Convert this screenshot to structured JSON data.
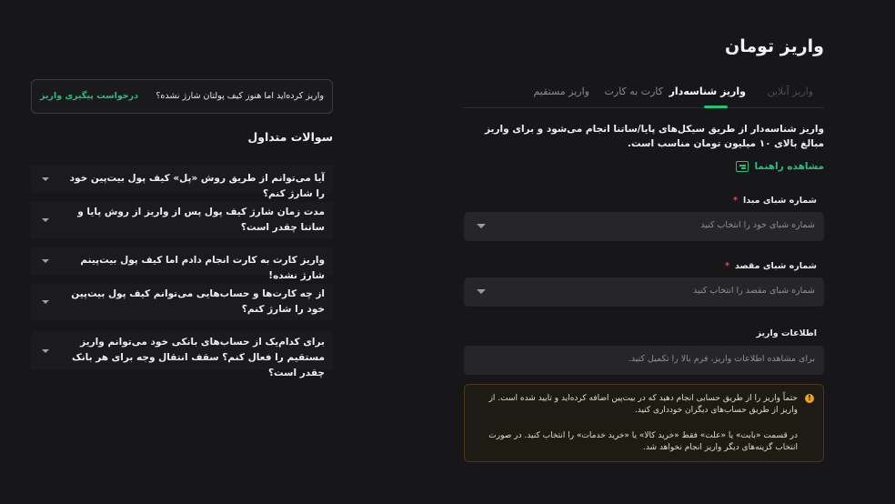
{
  "page": {
    "title": "واریز تومان"
  },
  "tabs": [
    {
      "label": "واریز آنلاین"
    },
    {
      "label": "واریز شناسه‌دار"
    },
    {
      "label": "کارت به کارت"
    },
    {
      "label": "واریز مستقیم"
    }
  ],
  "active_tab": "واریز شناسه‌دار",
  "description": "واریز شناسه‌دار از طریق سیکل‌های پایا/ساتنا انجام می‌شود و برای واریز مبالغ بالای ۱۰ میلیون تومان مناسب است.",
  "guide_link": "مشاهده راهنما",
  "fields": {
    "source_label": "شماره شبای مبدا",
    "source_placeholder": "شماره شبای خود را انتخاب کنید",
    "dest_label": "شماره شبای مقصد",
    "dest_placeholder": "شماره شبای مقصد را انتخاب کنید",
    "required_mark": "*",
    "info_label": "اطلاعات واریز",
    "info_placeholder": "برای مشاهده اطلاعات واریز، فرم بالا را تکمیل کنید."
  },
  "warning": {
    "icon": "!",
    "p1": "حتماً واریز را از طریق حسابی انجام دهید که در بیت‌پین اضافه کرده‌اید و تایید شده است. از واریز از طریق حساب‌های دیگران خودداری کنید.",
    "p2": "در قسمت «بابت» یا «علت» فقط «خرید کالا» یا «خرید خدمات» را انتخاب کنید. در صورت انتخاب گزینه‌های دیگر واریز انجام نخواهد شد."
  },
  "tracking": {
    "question": "واریز کرده‌اید اما هنوز کیف پولتان شارژ نشده؟",
    "link": "درخواست پیگیری واریز"
  },
  "faq": {
    "title": "سوالات متداول",
    "items": [
      "آیا می‌توانم از طریق روش «پل» کیف پول بیت‌پین خود را شارژ کنم؟",
      "مدت زمان شارژ کیف پول پس از واریز از روش پایا و ساتنا چقدر است؟",
      "واریز کارت به کارت انجام دادم اما کیف پول بیت‌پینم شارژ نشده!",
      "از چه کارت‌ها و حساب‌هایی می‌توانم کیف پول بیت‌پین خود را شارژ کنم؟",
      "برای کدام‌یک از حساب‌های بانکی خود می‌توانم واریز مستقیم را فعال کنم؟ سقف انتقال وجه برای هر بانک چقدر است؟"
    ]
  },
  "colors": {
    "accent": "#1fc37a",
    "background": "#17171a",
    "required": "#f0444a",
    "warning": "#e9a31a"
  }
}
